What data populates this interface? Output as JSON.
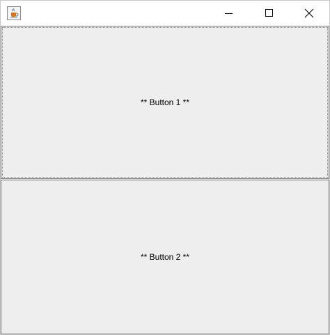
{
  "window": {
    "controls": {
      "minimize_icon": "minimize-icon",
      "maximize_icon": "maximize-icon",
      "close_icon": "close-icon"
    },
    "app_icon": "java-cup-icon"
  },
  "buttons": [
    {
      "label": "** Button 1 **",
      "focused": true
    },
    {
      "label": "** Button 2 **",
      "focused": false
    }
  ],
  "colors": {
    "content_background": "#eeeeee",
    "titlebar_background": "#ffffff",
    "button_border": "#7a7a7a"
  }
}
